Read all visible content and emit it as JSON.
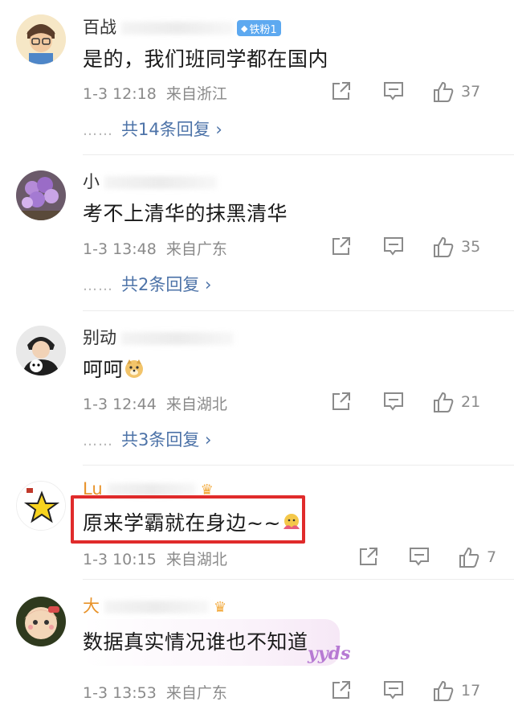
{
  "comments": [
    {
      "name_visible": "百战",
      "badge": "铁粉1",
      "text": "是的，我们班同学都在国内",
      "time": "1-3 12:18",
      "location": "来自浙江",
      "likes": "37",
      "replies": "共14条回复 ›",
      "dots": "……"
    },
    {
      "name_visible": "小",
      "text": "考不上清华的抹黑清华",
      "time": "1-3 13:48",
      "location": "来自广东",
      "likes": "35",
      "replies": "共2条回复 ›",
      "dots": "……"
    },
    {
      "name_visible": "别动",
      "text": "呵呵",
      "time": "1-3 12:44",
      "location": "来自湖北",
      "likes": "21",
      "replies": "共3条回复 ›",
      "dots": "……"
    },
    {
      "name_visible": "Lu",
      "text": "原来学霸就在身边~~",
      "time": "1-3 10:15",
      "location": "来自湖北",
      "likes": "7"
    },
    {
      "name_visible": "大",
      "text": "数据真实情况谁也不知道",
      "sticker": "yyds",
      "time": "1-3 13:53",
      "location": "来自广东",
      "likes": "17"
    }
  ],
  "colors": {
    "reply_link": "#4d73a8",
    "highlight_box": "#e02b2b",
    "gold_name": "#e8932a",
    "badge_bg": "#5da9f0"
  },
  "icons": [
    "share-icon",
    "comment-icon",
    "like-icon",
    "crown-icon"
  ]
}
